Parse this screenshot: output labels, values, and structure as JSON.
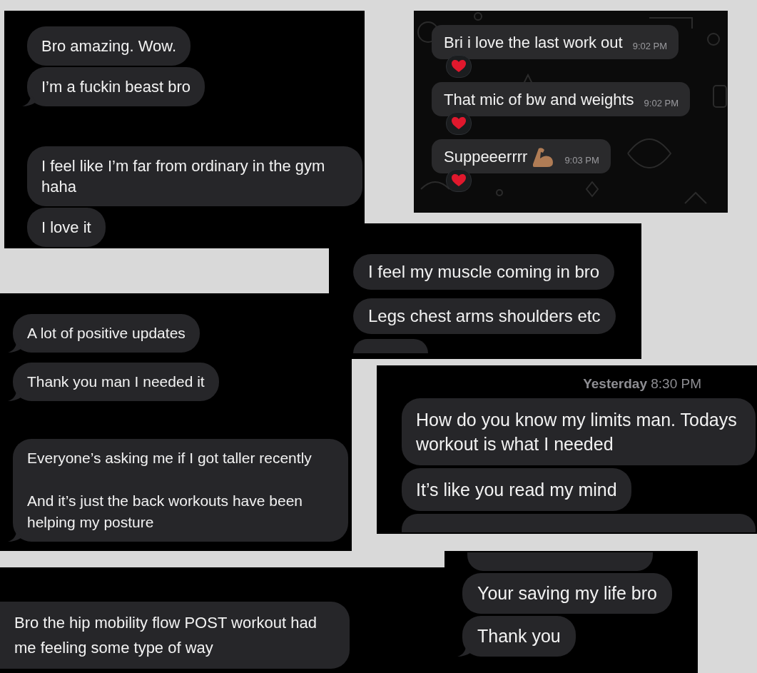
{
  "screenshots": [
    {
      "kind": "imessage",
      "messages": [
        {
          "kind": "text",
          "text": "Bro amazing. Wow.",
          "tail": false,
          "new_group": false
        },
        {
          "kind": "text",
          "text": "I’m a fuckin beast bro",
          "tail": true,
          "new_group": false
        },
        {
          "kind": "text",
          "text": "I feel like I’m far from ordinary in the gym haha",
          "tail": false,
          "new_group": true
        },
        {
          "kind": "text",
          "text": "I love it",
          "tail": false,
          "new_group": false
        }
      ]
    },
    {
      "kind": "whatsapp",
      "messages": [
        {
          "kind": "text",
          "text": "Bri i love the last work out",
          "time": "9:02 PM",
          "reacted": true
        },
        {
          "kind": "text",
          "text": "That mic of bw and weights",
          "time": "9:02 PM",
          "reacted": true
        },
        {
          "kind": "text",
          "text": "Suppeeerrrr",
          "flexed_arm": true,
          "time": "9:03 PM",
          "reacted": true
        }
      ]
    },
    {
      "kind": "imessage",
      "messages": [
        {
          "kind": "text",
          "text": "I feel my muscle coming in bro",
          "tail": false,
          "new_group": false
        },
        {
          "kind": "text",
          "text": "Legs chest arms shoulders etc",
          "tail": false,
          "new_group": false
        },
        {
          "kind": "bubble_top"
        }
      ]
    },
    {
      "kind": "imessage",
      "messages": [
        {
          "kind": "text",
          "text": "A lot of positive updates",
          "tail": true,
          "new_group": false
        },
        {
          "kind": "text",
          "text": "Thank you man I needed it",
          "tail": true,
          "new_group": false
        },
        {
          "kind": "text",
          "text": "Everyone’s asking me if I got taller recently\n\nAnd it’s just the back workouts have been helping my posture",
          "tail": true,
          "new_group": true
        }
      ]
    },
    {
      "kind": "imessage",
      "messages": [
        {
          "kind": "timestamp",
          "text": "**Yesterday** 8:30 PM"
        },
        {
          "kind": "text",
          "text": "How do you know my limits man. Todays workout is what I needed",
          "tail": false,
          "new_group": false
        },
        {
          "kind": "text",
          "text": "It’s like you read my mind",
          "tail": false,
          "new_group": false
        },
        {
          "kind": "bubble_top"
        }
      ]
    },
    {
      "kind": "imessage",
      "messages": [
        {
          "kind": "bubble_bottom"
        },
        {
          "kind": "text",
          "text": "Your saving my life bro",
          "tail": false,
          "new_group": false
        },
        {
          "kind": "text",
          "text": "Thank you",
          "tail": true,
          "new_group": false
        }
      ]
    },
    {
      "kind": "imessage",
      "messages": [
        {
          "kind": "text",
          "text": "Bro the hip mobility flow POST workout had me feeling some type of way",
          "tail": false,
          "new_group": true
        }
      ]
    }
  ]
}
